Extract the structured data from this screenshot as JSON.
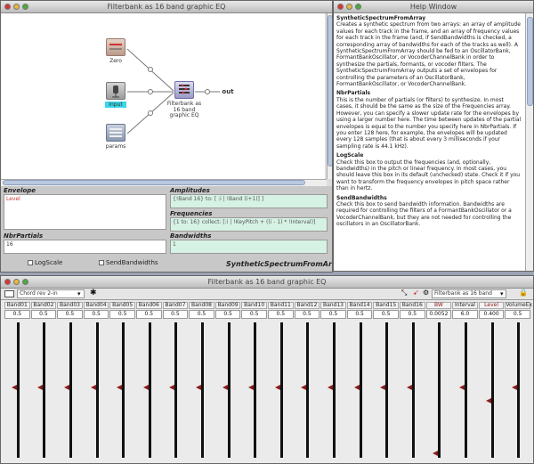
{
  "main_window": {
    "title": "Filterbank as 16 band graphic EQ",
    "nodes": {
      "zero_label": "Zero",
      "input_label": "Input",
      "synth_label": "Filterbank as 16 band graphic EQ",
      "params_label": "params",
      "output_label": "out"
    },
    "panel": {
      "envelope_label": "Envelope",
      "envelope_value": "Level",
      "amplitudes_label": "Amplitudes",
      "amplitudes_value": "{!Band 16} to: [ :i | !Band (i+1)] ]",
      "frequencies_label": "Frequencies",
      "frequencies_value": "{1 to: 16} collect: [:i | !KeyPitch + ((i - 1) * !Interval)]",
      "nbr_partials_label": "NbrPartials",
      "nbr_partials_value": "16",
      "bandwidths_label": "Bandwidths",
      "bandwidths_value": "1",
      "logscale_label": "LogScale",
      "sendbandwidths_label": "SendBandwidths",
      "class_label": "SyntheticSpectrumFromArray"
    }
  },
  "help_window": {
    "title": "Help Window",
    "heading": "SyntheticSpectrumFromArray",
    "intro": "Creates a synthetic spectrum from two arrays: an array of amplitude values for each track in the frame, and an array of frequency values for each track in the frame (and, if SendBandwidths is checked, a corresponding array of bandwidths for each of the tracks as well). A SyntheticSpectrumFromArray should be fed to an OscillatorBank, FormantBankOscillator, or VocoderChannelBank in order to synthesize the partials, formants, or vocoder filters. The SyntheticSpectrumFromArray outputs a set of envelopes for controlling the parameters of an OscillatorBank, FormantBankOscillator, or VocoderChannelBank.",
    "sections": [
      {
        "heading": "NbrPartials",
        "body": "This is the number of partials (or filters) to synthesize. In most cases, it should be the same as the size of the Frequencies array. However, you can specify a slower update rate for the envelopes by using a larger number here. The time between updates of the partial envelopes is equal to the number you specify here in NbrPartials. If you enter 128 here, for example, the envelopes will be updated every 128 samples (that is about every 3 milliseconds if your sampling rate is 44.1 kHz)."
      },
      {
        "heading": "LogScale",
        "body": "Check this box to output the frequencies (and, optionally, bandwidths) in the pitch or linear frequency. In most cases, you should leave this box in its default (unchecked) state. Check it if you want to transform the frequency envelopes in pitch space rather than in hertz."
      },
      {
        "heading": "SendBandwidths",
        "body": "Check this box to send bandwidth information. Bandwidths are required for controlling the filters of a FormantBankOscillator or a VocoderChannelBank, but they are not needed for controlling the oscillators in an OscillatorBank."
      }
    ]
  },
  "eq_window": {
    "title": "Filterbank as 16 band graphic EQ",
    "preset_value": "Chord rev 2-in",
    "sound_selector": "Filterbank as 16 band",
    "bands": [
      {
        "name": "Band01",
        "value": "0.5",
        "level": 0.5
      },
      {
        "name": "Band02",
        "value": "0.5",
        "level": 0.5
      },
      {
        "name": "Band03",
        "value": "0.5",
        "level": 0.5
      },
      {
        "name": "Band04",
        "value": "0.5",
        "level": 0.5
      },
      {
        "name": "Band05",
        "value": "0.5",
        "level": 0.5
      },
      {
        "name": "Band06",
        "value": "0.5",
        "level": 0.5
      },
      {
        "name": "Band07",
        "value": "0.5",
        "level": 0.5
      },
      {
        "name": "Band08",
        "value": "0.5",
        "level": 0.5
      },
      {
        "name": "Band09",
        "value": "0.5",
        "level": 0.5
      },
      {
        "name": "Band10",
        "value": "0.5",
        "level": 0.5
      },
      {
        "name": "Band11",
        "value": "0.5",
        "level": 0.5
      },
      {
        "name": "Band12",
        "value": "0.5",
        "level": 0.5
      },
      {
        "name": "Band13",
        "value": "0.5",
        "level": 0.5
      },
      {
        "name": "Band14",
        "value": "0.5",
        "level": 0.5
      },
      {
        "name": "Band15",
        "value": "0.5",
        "level": 0.5
      },
      {
        "name": "Band16",
        "value": "0.5",
        "level": 0.5
      },
      {
        "name": "BW",
        "value": "0.0052",
        "level": 0.015
      },
      {
        "name": "Interval",
        "value": "6.0",
        "level": 0.5
      },
      {
        "name": "Level",
        "value": "0.400",
        "level": 0.4
      },
      {
        "name": "VolumeEx",
        "value": "0.5",
        "level": 0.5
      }
    ]
  },
  "colors": {
    "knob": "#8a1a1a",
    "header_text": "#8a1a1a",
    "accent_green": "#d6f2e4"
  }
}
